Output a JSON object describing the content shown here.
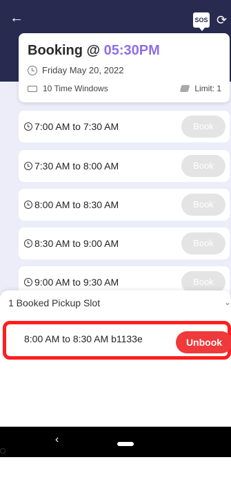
{
  "header": {
    "back_icon": "arrow-left-icon",
    "sos_label": "SOS",
    "refresh_icon": "refresh-icon"
  },
  "card": {
    "title_prefix": "Booking @",
    "title_time": "05:30PM",
    "date": "Friday May 20, 2022",
    "windows": "10 Time Windows",
    "limit": "Limit: 1"
  },
  "slots": [
    {
      "label": "7:00 AM to 7:30 AM",
      "button": "Book"
    },
    {
      "label": "7:30 AM to 8:00 AM",
      "button": "Book"
    },
    {
      "label": "8:00 AM to 8:30 AM",
      "button": "Book"
    },
    {
      "label": "8:30 AM to 9:00 AM",
      "button": "Book"
    },
    {
      "label": "9:00 AM to 9:30 AM",
      "button": "Book"
    }
  ],
  "sheet": {
    "title": "1 Booked Pickup Slot",
    "booked_label": "8:00 AM to 8:30 AM b1133e",
    "unbook_label": "Unbook"
  },
  "colors": {
    "header_bg": "#282b4f",
    "accent": "#8f6fe6",
    "unbook": "#f0393a",
    "highlight": "#ff1e1e"
  }
}
